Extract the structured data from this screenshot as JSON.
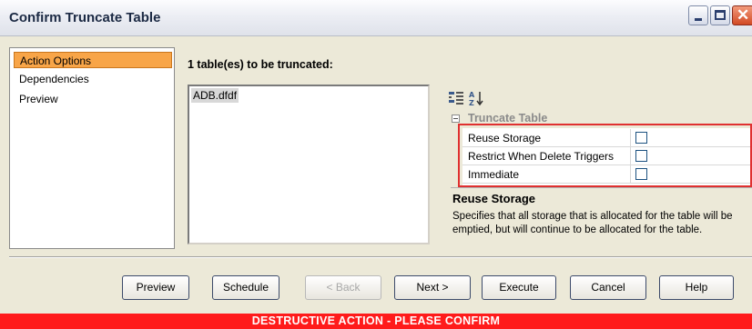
{
  "window": {
    "title": "Confirm Truncate Table"
  },
  "nav": {
    "items": [
      {
        "label": "Action Options",
        "selected": true
      },
      {
        "label": "Dependencies",
        "selected": false
      },
      {
        "label": "Preview",
        "selected": false
      }
    ]
  },
  "main": {
    "heading": "1 table(es) to be truncated:",
    "tables": [
      "ADB.dfdf"
    ]
  },
  "property_grid": {
    "toolbar": {
      "categorized_icon": "categorized-view-icon",
      "sort_icon": "sort-alphabetical-icon"
    },
    "category": "Truncate Table",
    "rows": [
      {
        "label": "Reuse Storage",
        "checked": false
      },
      {
        "label": "Restrict When Delete Triggers",
        "checked": false
      },
      {
        "label": "Immediate",
        "checked": false
      }
    ],
    "highlight_color": "#e03030"
  },
  "description": {
    "title": "Reuse Storage",
    "text": "Specifies that all storage that is allocated for the table will be emptied, but will continue to be allocated for the table."
  },
  "buttons": {
    "preview": "Preview",
    "schedule": "Schedule",
    "back": "< Back",
    "next": "Next >",
    "execute": "Execute",
    "cancel": "Cancel",
    "help": "Help"
  },
  "banner": {
    "text": "DESTRUCTIVE ACTION - PLEASE CONFIRM",
    "color": "#ff1b1b"
  },
  "colors": {
    "selected_nav": "#f8a548",
    "window_bg": "#ece9d8"
  }
}
